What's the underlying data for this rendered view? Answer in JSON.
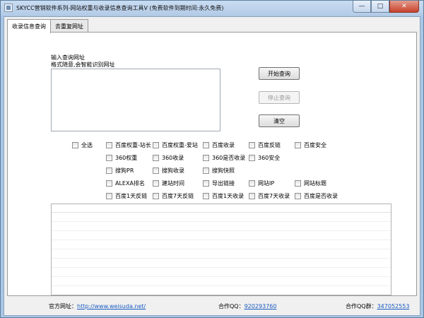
{
  "window": {
    "title": "SKYCC营销软件系列-网站权重与收录信息查询工具V (免费软件到期时间:永久免费)",
    "minimize": "—",
    "maximize": "□",
    "close": "✕"
  },
  "tabs": [
    {
      "label": "收录信息查询"
    },
    {
      "label": "去重复网址"
    }
  ],
  "input": {
    "label_line1": "输入查询网址",
    "label_line2": "格式随意,会智能识别网址",
    "value": ""
  },
  "buttons": {
    "start": "开始查询",
    "stop": "停止查询",
    "clear": "清空"
  },
  "options": {
    "select_all": "全选",
    "row1": [
      "百度权重-站长",
      "百度权重-爱站",
      "百度收录",
      "百度反链",
      "百度安全"
    ],
    "row2": [
      "360权重",
      "360收录",
      "360是否收录",
      "360安全"
    ],
    "row3": [
      "搜狗PR",
      "搜狗收录",
      "搜狗快照"
    ],
    "row4": [
      "ALEXA排名",
      "建站时间",
      "导出链接",
      "网站IP",
      "网站标题"
    ],
    "row5": [
      "百度1天反链",
      "百度7天反链",
      "百度1天收录",
      "百度7天收录",
      "百度是否收录"
    ]
  },
  "footer": {
    "site_label": "官方网址：",
    "site_url": "http://www.weisuda.net/",
    "qq_label": "合作QQ：",
    "qq_value": "920293760",
    "group_label": "合作QQ群：",
    "group_value": "347052553"
  }
}
